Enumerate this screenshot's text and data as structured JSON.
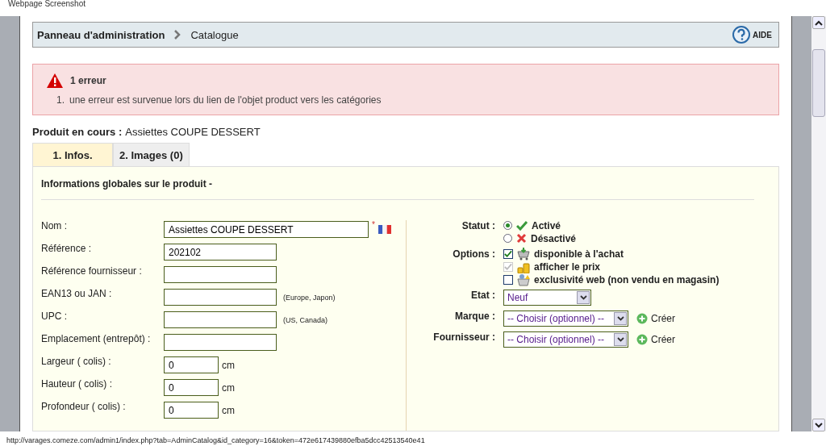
{
  "caption": "Webpage Screenshot",
  "breadcrumb": {
    "items": [
      "Panneau d'administration",
      "Catalogue"
    ],
    "help": "AIDE"
  },
  "error": {
    "title": "1 erreur",
    "messages": [
      "une erreur est survenue lors du lien de l'objet product vers les catégories"
    ],
    "numbers": [
      "1."
    ]
  },
  "current_product": {
    "label": "Produit en cours :",
    "value": "Assiettes COUPE DESSERT"
  },
  "tabs": [
    {
      "label": "1. Infos.",
      "selected": true
    },
    {
      "label": "2. Images (0)",
      "selected": false
    }
  ],
  "panel_title": "Informations globales sur le produit -",
  "fields": [
    {
      "label": "Nom :",
      "value": "Assiettes COUPE DESSERT",
      "kind": "long",
      "required_mark": "*"
    },
    {
      "label": "Référence :",
      "value": "202102",
      "kind": "medium"
    },
    {
      "label": "Référence fournisseur :",
      "kind": "medium"
    },
    {
      "label": "EAN13 ou JAN :",
      "kind": "medium",
      "hint": "(Europe, Japon)"
    },
    {
      "label": "UPC :",
      "kind": "medium",
      "hint": "(US, Canada)"
    },
    {
      "label": "Emplacement (entrepôt) :",
      "kind": "medium"
    },
    {
      "label": "Largeur ( colis) :",
      "value": "0",
      "kind": "short",
      "unit": "cm"
    },
    {
      "label": "Hauteur ( colis) :",
      "value": "0",
      "kind": "short",
      "unit": "cm"
    },
    {
      "label": "Profondeur ( colis) :",
      "value": "0",
      "kind": "short",
      "unit": "cm"
    }
  ],
  "status": {
    "label": "Statut :",
    "options": [
      {
        "label": "Activé",
        "selected": true,
        "kind": "check"
      },
      {
        "label": "Désactivé",
        "selected": false,
        "kind": "cross"
      }
    ]
  },
  "options": {
    "label": "Options :",
    "items": [
      {
        "label": "disponible à l'achat",
        "checked": true,
        "disabled": false,
        "kind": "cart"
      },
      {
        "label": "afficher le prix",
        "checked": true,
        "disabled": true,
        "kind": "coins"
      },
      {
        "label": "exclusivité web (non vendu en magasin)",
        "checked": false,
        "disabled": false,
        "kind": "basket"
      }
    ]
  },
  "selects": [
    {
      "label": "Etat :",
      "value": "Neuf",
      "kind": "short"
    },
    {
      "label": "Marque :",
      "value": "-- Choisir (optionnel) --",
      "kind": "long",
      "action": "Créer"
    },
    {
      "label": "Fournisseur :",
      "value": "-- Choisir (optionnel) --",
      "kind": "long",
      "action": "Créer"
    }
  ],
  "status_bar": "http://varages.comeze.com/admin1/index.php?tab=AdminCatalog&id_category=16&token=472e617439880efba5dcc42513540e41"
}
